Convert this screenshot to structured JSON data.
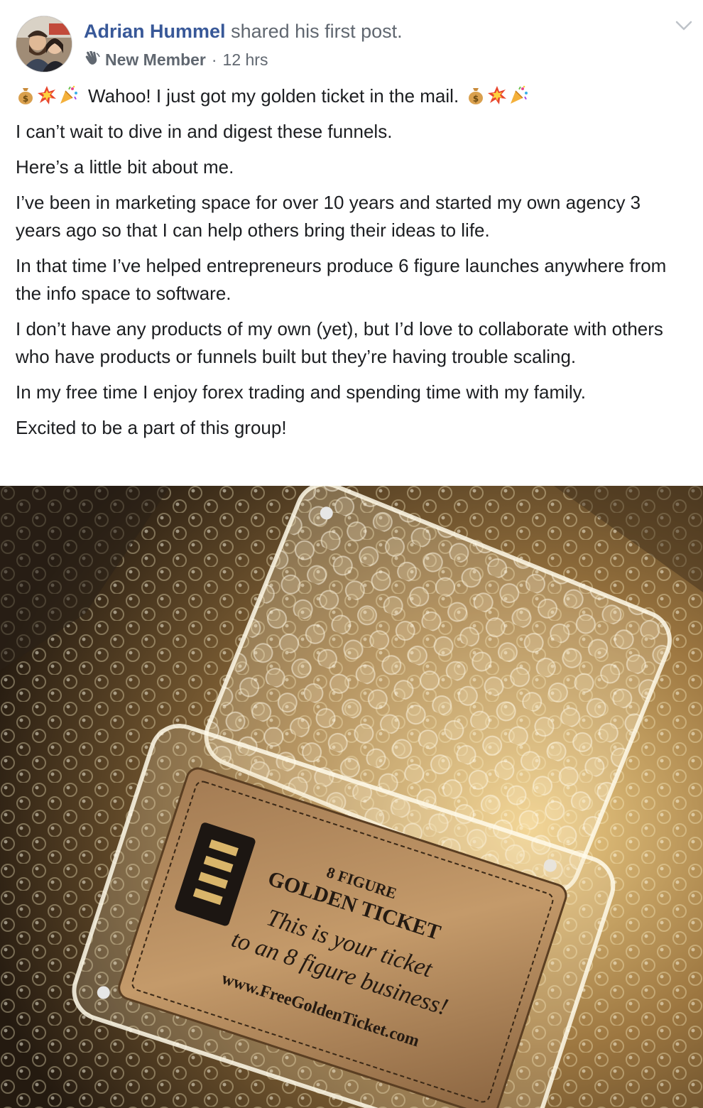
{
  "post": {
    "author_name": "Adrian Hummel",
    "action_text": "shared his first post.",
    "badge_icon": "waving-hand-icon",
    "badge_label": "New Member",
    "separator": "·",
    "timestamp": "12 hrs",
    "options_icon": "chevron-down-icon",
    "emoji_sequence": [
      "money-bag-icon",
      "collision-icon",
      "party-popper-icon"
    ],
    "headline": "Wahoo! I just got my golden ticket in the mail.",
    "paragraphs": [
      "I can’t wait to dive in and digest these funnels.",
      "Here’s a little bit about me.",
      "I’ve been in marketing space for over 10 years and started my own agency 3 years ago so that I can help others bring their ideas to life.",
      "In that time I’ve helped entrepreneurs produce 6 figure launches anywhere from the info space to software.",
      "I don’t have any products of my own (yet), but I’d love to collaborate with others who have products or funnels built but they’re having trouble scaling.",
      "In my free time I enjoy forex trading and spending time with my family.",
      "Excited to be a part of this group!"
    ]
  },
  "photo": {
    "ticket_brand": "8 FIGURE",
    "ticket_title": "GOLDEN TICKET",
    "ticket_line1": "This is your ticket",
    "ticket_line2": "to an 8 figure business!",
    "ticket_url": "www.FreeGoldenTicket.com"
  },
  "colors": {
    "link_blue": "#385898",
    "secondary_text": "#606770",
    "body_text": "#1c1e21",
    "gold": "#c9a35a"
  }
}
